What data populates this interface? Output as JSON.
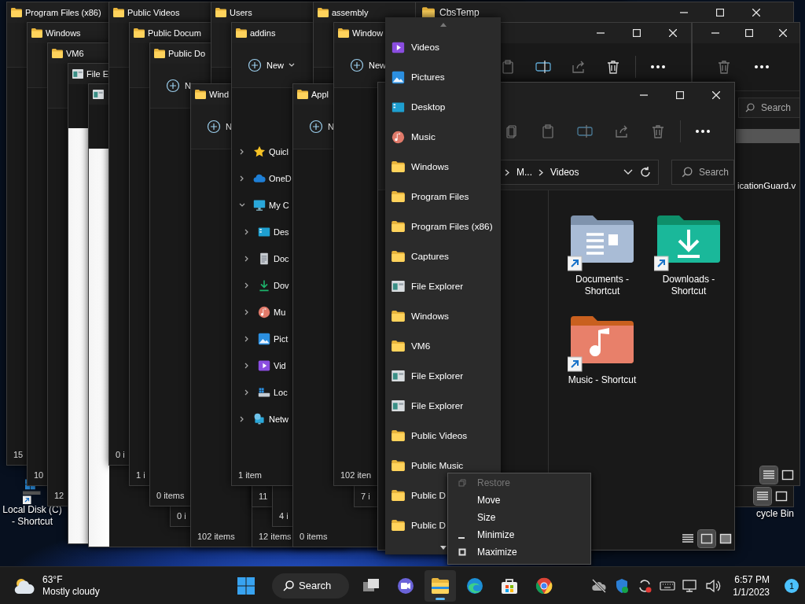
{
  "desktop_icons": [
    {
      "label": "Local Disk (C) - Shortcut",
      "kind": "drive"
    },
    {
      "label": "cycle Bin",
      "kind": "hidden"
    }
  ],
  "windows": [
    {
      "title": "Program Files (x86)",
      "kind": "folder",
      "status": "15"
    },
    {
      "title": "Public Videos",
      "kind": "folder",
      "status": "0 i"
    },
    {
      "title": "Users",
      "kind": "folder"
    },
    {
      "title": "assembly",
      "kind": "folder"
    },
    {
      "title": "Windows",
      "kind": "folder",
      "status": "10"
    },
    {
      "title": "Public Docum",
      "kind": "folder",
      "status": "1 i"
    },
    {
      "title": "addins",
      "kind": "folder",
      "new_label": "New",
      "new_caret": true,
      "status": "1 item",
      "nav": [
        {
          "label": "Quicl",
          "kind": "star",
          "expanded": false
        },
        {
          "label": "OneD",
          "kind": "cloud",
          "expanded": false
        },
        {
          "label": "My C",
          "kind": "monitor",
          "expanded": true,
          "children": [
            {
              "label": "Des",
              "kind": "desktop",
              "expanded": false
            },
            {
              "label": "Doc",
              "kind": "document",
              "expanded": false
            },
            {
              "label": "Dov",
              "kind": "download",
              "expanded": false
            },
            {
              "label": "Mu",
              "kind": "music",
              "expanded": false
            },
            {
              "label": "Pict",
              "kind": "picture",
              "expanded": false
            },
            {
              "label": "Vid",
              "kind": "video",
              "expanded": false
            },
            {
              "label": "Loc",
              "kind": "drive",
              "expanded": false
            }
          ]
        },
        {
          "label": "Netw",
          "kind": "network",
          "expanded": false
        }
      ]
    },
    {
      "title": "Window",
      "kind": "folder",
      "new_label": "New",
      "status": "102 iten"
    },
    {
      "title": "VM6",
      "kind": "folder",
      "status": "12"
    },
    {
      "title": "Public Do",
      "kind": "folder",
      "new_label": "N",
      "status": "0 items"
    },
    {
      "kind": "untitled",
      "status": "11"
    },
    {
      "kind": "untitled",
      "status": "7 i"
    },
    {
      "title": "File E",
      "kind": "explorer"
    },
    {
      "kind": "untitled",
      "status": "0 i"
    },
    {
      "kind": "untitled",
      "status": "4 i"
    },
    {
      "kind": "explorer"
    },
    {
      "title": "Wind",
      "kind": "folder",
      "new_label": "N",
      "status": "102 items"
    },
    {
      "kind": "untitled",
      "status": "12 items"
    },
    {
      "title": "Appl",
      "kind": "folder",
      "new_label": "N",
      "status": "0 items"
    }
  ],
  "cbs_window": {
    "title": "CbsTemp",
    "view_buttons": [
      {
        "selected": true
      },
      {
        "selected": false
      }
    ]
  },
  "side_window": {
    "search_placeholder": "Search",
    "file_label": "icationGuard.v",
    "view_buttons": [
      {
        "selected": true
      },
      {
        "selected": false
      }
    ]
  },
  "front_window": {
    "breadcrumb": [
      "M...",
      "Videos"
    ],
    "search_placeholder": "Search",
    "items": [
      {
        "label": "Documents - Shortcut",
        "kind": "documents"
      },
      {
        "label": "Downloads - Shortcut",
        "kind": "downloads"
      },
      {
        "label": "Music - Shortcut",
        "kind": "music"
      }
    ],
    "view_buttons": [
      {
        "selected": false
      },
      {
        "selected": true
      },
      {
        "selected": false
      }
    ]
  },
  "jump_list": {
    "items": [
      {
        "label": "Videos",
        "kind": "video"
      },
      {
        "label": "Pictures",
        "kind": "picture"
      },
      {
        "label": "Desktop",
        "kind": "desktop"
      },
      {
        "label": "Music",
        "kind": "music"
      },
      {
        "label": "Windows",
        "kind": "folder"
      },
      {
        "label": "Program Files",
        "kind": "folder"
      },
      {
        "label": "Program Files (x86)",
        "kind": "folder"
      },
      {
        "label": "Captures",
        "kind": "folder"
      },
      {
        "label": "File Explorer",
        "kind": "explorer"
      },
      {
        "label": "Windows",
        "kind": "folder"
      },
      {
        "label": "VM6",
        "kind": "folder"
      },
      {
        "label": "File Explorer",
        "kind": "explorer"
      },
      {
        "label": "File Explorer",
        "kind": "explorer"
      },
      {
        "label": "Public Videos",
        "kind": "folder"
      },
      {
        "label": "Public Music",
        "kind": "folder"
      },
      {
        "label": "Public D",
        "kind": "folder"
      },
      {
        "label": "Public D",
        "kind": "folder"
      }
    ]
  },
  "context_menu": {
    "items": [
      {
        "label": "Restore",
        "kind": "restore",
        "disabled": true
      },
      {
        "label": "Move",
        "kind": "plain",
        "disabled": false
      },
      {
        "label": "Size",
        "kind": "plain",
        "disabled": false
      },
      {
        "label": "Minimize",
        "kind": "minimize",
        "disabled": false
      },
      {
        "label": "Maximize",
        "kind": "maximize",
        "disabled": false
      }
    ]
  },
  "taskbar": {
    "weather": {
      "temperature": "63°F",
      "condition": "Mostly cloudy"
    },
    "search_label": "Search",
    "apps": [
      {
        "kind": "task-view",
        "active": false
      },
      {
        "kind": "chat",
        "active": false
      },
      {
        "kind": "file-explorer",
        "active": true
      },
      {
        "kind": "swirl-browser",
        "active": false
      },
      {
        "kind": "store",
        "active": false
      },
      {
        "kind": "ring-browser",
        "active": false
      }
    ],
    "time": "6:57 PM",
    "date": "1/1/2023",
    "notification_count": "1"
  }
}
